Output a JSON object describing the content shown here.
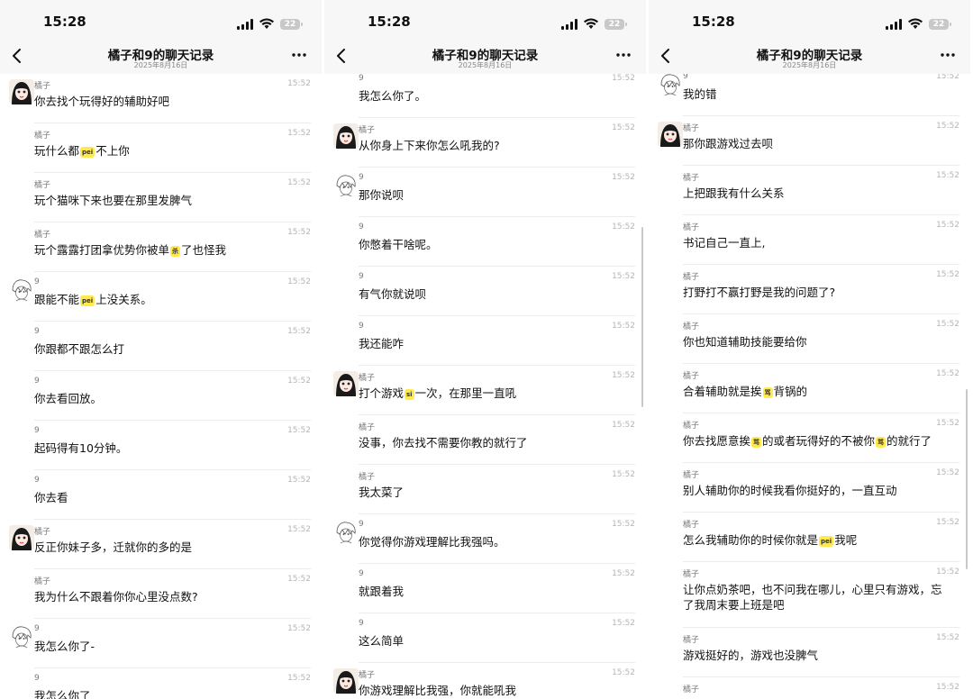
{
  "screens": [
    {
      "time": "15:28",
      "battery": "22",
      "title": "橘子和9的聊天记录",
      "date": "2025年8月16日",
      "messages": [
        {
          "sender": "橘子",
          "time": "15:52",
          "text": "你去找个玩得好的辅助好吧",
          "avatar": "girl"
        },
        {
          "sender": "橘子",
          "time": "15:52",
          "pre": "玩什么都",
          "sticker": "pei",
          "post": "不上你"
        },
        {
          "sender": "橘子",
          "time": "15:52",
          "text": "玩个猫咪下来也要在那里发脾气"
        },
        {
          "sender": "橘子",
          "time": "15:52",
          "pre": "玩个露露打团拿优势你被单",
          "sticker": "杀",
          "post": "了也怪我"
        },
        {
          "sender": "9",
          "time": "15:52",
          "pre": "跟能不能",
          "sticker": "pei",
          "post": "上没关系。",
          "avatar": "boy"
        },
        {
          "sender": "9",
          "time": "15:52",
          "text": "你跟都不跟怎么打"
        },
        {
          "sender": "9",
          "time": "15:52",
          "text": "你去看回放。"
        },
        {
          "sender": "9",
          "time": "15:52",
          "text": "起码得有10分钟。"
        },
        {
          "sender": "9",
          "time": "15:52",
          "text": "你去看"
        },
        {
          "sender": "橘子",
          "time": "15:52",
          "text": "反正你妹子多，迁就你的多的是",
          "avatar": "girl"
        },
        {
          "sender": "橘子",
          "time": "15:52",
          "text": "我为什么不跟着你你心里没点数?"
        },
        {
          "sender": "9",
          "time": "15:52",
          "text": "我怎么你了-",
          "avatar": "boy"
        },
        {
          "sender": "9",
          "time": "15:52",
          "text": "我怎么你了"
        }
      ]
    },
    {
      "time": "15:28",
      "battery": "22",
      "title": "橘子和9的聊天记录",
      "date": "2025年8月16日",
      "messages": [
        {
          "sender": "9",
          "time": "15:52",
          "text": "我怎么你了。"
        },
        {
          "sender": "橘子",
          "time": "15:52",
          "text": "从你身上下来你怎么吼我的?",
          "avatar": "girl"
        },
        {
          "sender": "9",
          "time": "15:52",
          "text": "那你说呗",
          "avatar": "boy"
        },
        {
          "sender": "9",
          "time": "15:52",
          "text": "你憋着干啥呢。"
        },
        {
          "sender": "9",
          "time": "15:52",
          "text": "有气你就说呗"
        },
        {
          "sender": "9",
          "time": "15:52",
          "text": "我还能咋"
        },
        {
          "sender": "橘子",
          "time": "15:52",
          "pre": "打个游戏",
          "sticker": "si",
          "post": "一次，在那里一直吼",
          "avatar": "girl"
        },
        {
          "sender": "橘子",
          "time": "15:52",
          "text": "没事，你去找不需要你教的就行了"
        },
        {
          "sender": "橘子",
          "time": "15:52",
          "text": "我太菜了"
        },
        {
          "sender": "9",
          "time": "15:52",
          "text": "你觉得你游戏理解比我强吗。",
          "avatar": "boy"
        },
        {
          "sender": "9",
          "time": "15:52",
          "text": "就跟着我"
        },
        {
          "sender": "9",
          "time": "15:52",
          "text": "这么简单"
        },
        {
          "sender": "橘子",
          "time": "15:52",
          "text": "你游戏理解比我强，你就能吼我",
          "avatar": "girl"
        }
      ]
    },
    {
      "time": "15:28",
      "battery": "22",
      "title": "橘子和9的聊天记录",
      "date": "2025年8月16日",
      "messages": [
        {
          "sender": "9",
          "time": "15:52",
          "text": "我的错",
          "avatar": "boy"
        },
        {
          "sender": "橘子",
          "time": "15:52",
          "text": "那你跟游戏过去呗",
          "avatar": "girl"
        },
        {
          "sender": "橘子",
          "time": "15:52",
          "text": "上把跟我有什么关系"
        },
        {
          "sender": "橘子",
          "time": "15:52",
          "text": "书记自己一直上,"
        },
        {
          "sender": "橘子",
          "time": "15:52",
          "text": "打野打不赢打野是我的问题了?"
        },
        {
          "sender": "橘子",
          "time": "15:52",
          "text": "你也知道辅助技能要给你"
        },
        {
          "sender": "橘子",
          "time": "15:52",
          "pre": "合着辅助就是挨",
          "sticker": "骂",
          "post": "背锅的"
        },
        {
          "sender": "橘子",
          "time": "15:52",
          "pre": "你去找愿意挨",
          "sticker": "骂",
          "mid": "的或者玩得好的不被你",
          "sticker2": "骂",
          "post": "的就行了"
        },
        {
          "sender": "橘子",
          "time": "15:52",
          "text": "别人辅助你的时候我看你挺好的，一直互动"
        },
        {
          "sender": "橘子",
          "time": "15:52",
          "pre": "怎么我辅助你的时候你就是",
          "sticker": "pei",
          "post": "我呢"
        },
        {
          "sender": "橘子",
          "time": "15:52",
          "text": "让你点奶茶吧，也不问我在哪儿，心里只有游戏，忘了我周末要上班是吧",
          "tall": true
        },
        {
          "sender": "橘子",
          "time": "15:52",
          "text": "游戏挺好的，游戏也没脾气"
        },
        {
          "sender": "橘子",
          "time": "15:52",
          "text": ""
        }
      ]
    }
  ]
}
